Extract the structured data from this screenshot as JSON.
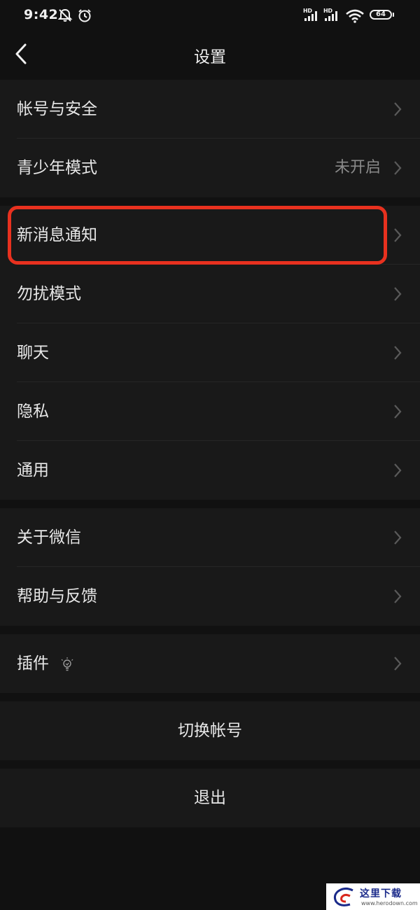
{
  "status_bar": {
    "time": "9:42",
    "hd1": "HD",
    "hd2": "HD",
    "battery": "64"
  },
  "nav": {
    "title": "设置"
  },
  "groups": {
    "account": [
      {
        "label": "帐号与安全",
        "value": ""
      },
      {
        "label": "青少年模式",
        "value": "未开启"
      }
    ],
    "settings": [
      {
        "label": "新消息通知",
        "value": ""
      },
      {
        "label": "勿扰模式",
        "value": ""
      },
      {
        "label": "聊天",
        "value": ""
      },
      {
        "label": "隐私",
        "value": ""
      },
      {
        "label": "通用",
        "value": ""
      }
    ],
    "about": [
      {
        "label": "关于微信",
        "value": ""
      },
      {
        "label": "帮助与反馈",
        "value": ""
      }
    ],
    "plugins": [
      {
        "label": "插件",
        "value": ""
      }
    ]
  },
  "actions": {
    "switch_account": "切换帐号",
    "logout": "退出"
  },
  "watermark": {
    "text": "这里下载",
    "url": "www.herodown.com"
  },
  "colors": {
    "background": "#111111",
    "cell": "#191919",
    "highlight": "#e8311f"
  }
}
